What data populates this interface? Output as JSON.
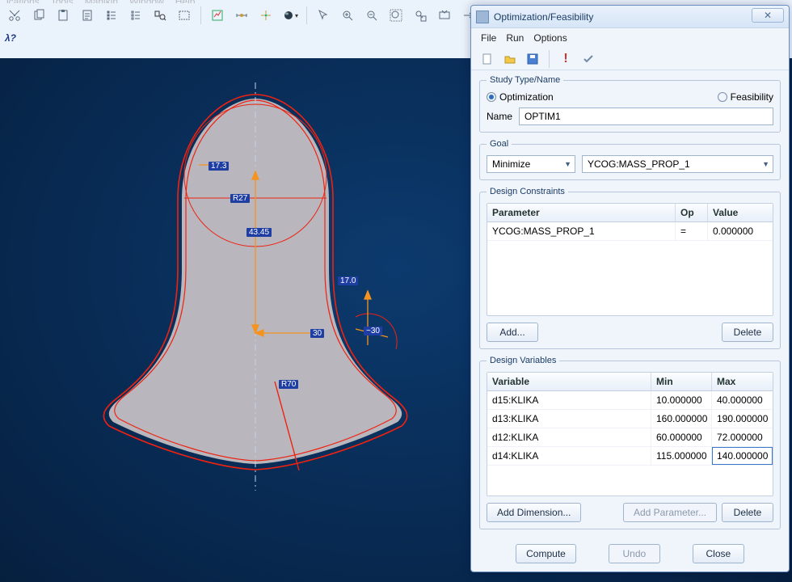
{
  "main_menu": [
    "ications",
    "Tools",
    "Manikin",
    "Window",
    "Help"
  ],
  "prompt": "λ?",
  "dialog": {
    "title": "Optimization/Feasibility",
    "menu": [
      "File",
      "Run",
      "Options"
    ],
    "study_type": {
      "legend": "Study Type/Name",
      "opt_label": "Optimization",
      "feas_label": "Feasibility",
      "name_label": "Name",
      "name_value": "OPTIM1"
    },
    "goal": {
      "legend": "Goal",
      "mode": "Minimize",
      "param": "YCOG:MASS_PROP_1"
    },
    "constraints": {
      "legend": "Design Constraints",
      "cols": {
        "p": "Parameter",
        "op": "Op",
        "val": "Value"
      },
      "rows": [
        {
          "p": "YCOG:MASS_PROP_1",
          "op": "=",
          "val": "0.000000"
        }
      ],
      "add": "Add...",
      "delete": "Delete"
    },
    "vars": {
      "legend": "Design Variables",
      "cols": {
        "v": "Variable",
        "min": "Min",
        "max": "Max"
      },
      "rows": [
        {
          "v": "d15:KLIKA",
          "min": "10.000000",
          "max": "40.000000"
        },
        {
          "v": "d13:KLIKA",
          "min": "160.000000",
          "max": "190.000000"
        },
        {
          "v": "d12:KLIKA",
          "min": "60.000000",
          "max": "72.000000"
        },
        {
          "v": "d14:KLIKA",
          "min": "115.000000",
          "max": "140.000000"
        }
      ],
      "add_dim": "Add Dimension...",
      "add_par": "Add Parameter...",
      "delete": "Delete"
    },
    "foot": {
      "compute": "Compute",
      "undo": "Undo",
      "close": "Close"
    }
  },
  "viewport": {
    "dims": {
      "d1": "17.3",
      "d2": "R27",
      "d3": "43.45",
      "d4": "30",
      "d5": "17.0",
      "d6": "~30",
      "d7": "R70"
    }
  }
}
